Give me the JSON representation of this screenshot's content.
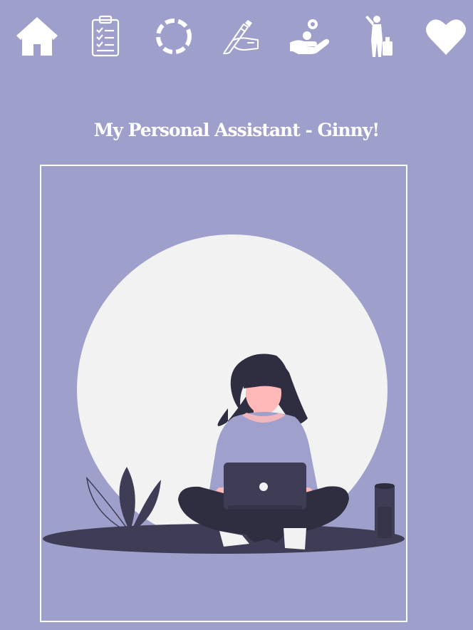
{
  "colors": {
    "background": "#9f9fcb",
    "icon": "#ffffff",
    "title": "#ffffff",
    "frame_border": "#ffffff",
    "moon": "#f2f2f2",
    "dark": "#3f3d56",
    "hair": "#2f2e41",
    "skin": "#ffb8b8",
    "sweater": "#a0a0cc"
  },
  "nav": {
    "items": [
      {
        "icon": "home-icon",
        "label": ""
      },
      {
        "icon": "clipboard-checklist-icon",
        "label": ""
      },
      {
        "icon": "loading-circle-icon",
        "label": ""
      },
      {
        "icon": "hand-writing-icon",
        "label": ""
      },
      {
        "icon": "money-hand-icon",
        "label": ""
      },
      {
        "icon": "traveler-icon",
        "label": ""
      },
      {
        "icon": "heart-icon",
        "label": ""
      }
    ]
  },
  "main": {
    "title": "My Personal Assistant - Ginny!",
    "illustration": {
      "subject": "woman-working-on-laptop",
      "accessories": [
        "plant",
        "smart-speaker"
      ]
    }
  }
}
